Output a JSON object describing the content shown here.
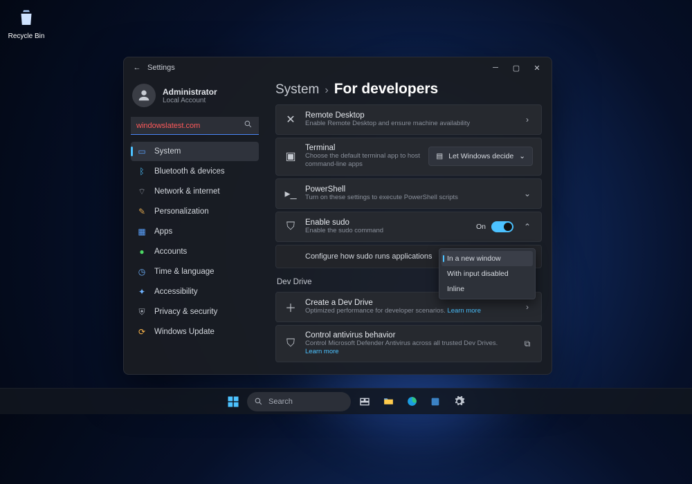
{
  "desktop": {
    "recycle_bin": "Recycle Bin"
  },
  "window": {
    "title": "Settings"
  },
  "user": {
    "name": "Administrator",
    "sub": "Local Account"
  },
  "search": {
    "value": "windowslatest.com"
  },
  "nav": {
    "system": "System",
    "bluetooth": "Bluetooth & devices",
    "network": "Network & internet",
    "personalization": "Personalization",
    "apps": "Apps",
    "accounts": "Accounts",
    "time": "Time & language",
    "accessibility": "Accessibility",
    "privacy": "Privacy & security",
    "update": "Windows Update"
  },
  "breadcrumb": {
    "root": "System",
    "leaf": "For developers"
  },
  "cards": {
    "remote": {
      "title": "Remote Desktop",
      "sub": "Enable Remote Desktop and ensure machine availability"
    },
    "terminal": {
      "title": "Terminal",
      "sub": "Choose the default terminal app to host command-line apps",
      "dropdown": "Let Windows decide"
    },
    "powershell": {
      "title": "PowerShell",
      "sub": "Turn on these settings to execute PowerShell scripts"
    },
    "sudo": {
      "title": "Enable sudo",
      "sub": "Enable the sudo command",
      "toggle_label": "On",
      "config": "Configure how sudo runs applications",
      "options": {
        "new_window": "In a new window",
        "input_disabled": "With input disabled",
        "inline": "Inline"
      }
    },
    "dev_drive_section": "Dev Drive",
    "create_dev_drive": {
      "title": "Create a Dev Drive",
      "sub": "Optimized performance for developer scenarios.",
      "link": "Learn more"
    },
    "antivirus": {
      "title": "Control antivirus behavior",
      "sub": "Control Microsoft Defender Antivirus across all trusted Dev Drives.",
      "link": "Learn more"
    }
  },
  "taskbar": {
    "search": "Search"
  },
  "colors": {
    "accent": "#4cc2ff"
  }
}
